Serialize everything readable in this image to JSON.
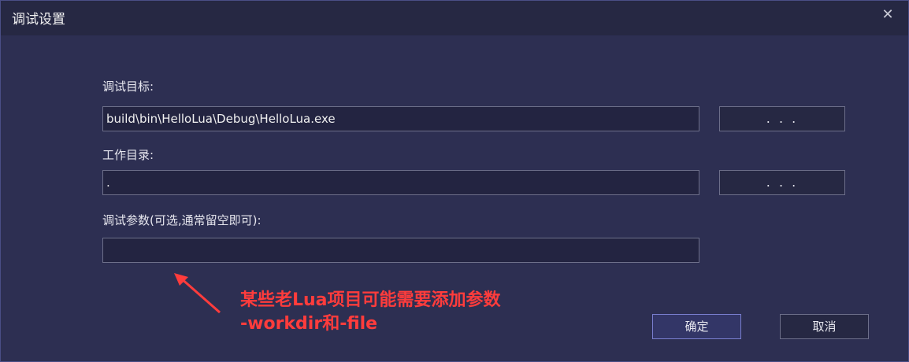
{
  "dialog": {
    "title": "调试设置",
    "close_icon": "close-icon"
  },
  "form": {
    "target_label": "调试目标:",
    "target_value": "build\\bin\\HelloLua\\Debug\\HelloLua.exe",
    "workdir_label": "工作目录:",
    "workdir_value": ".",
    "args_label": "调试参数(可选,通常留空即可):",
    "args_value": "",
    "browse_label": ". . ."
  },
  "buttons": {
    "ok_label": "确定",
    "cancel_label": "取消"
  },
  "annotation": {
    "line1": "某些老Lua项目可能需要添加参数",
    "line2": "-workdir和-file",
    "color": "#ff3c3c"
  },
  "colors": {
    "background": "#2d2f52",
    "titlebar": "#262843",
    "field": "#232441",
    "accent_border": "#7a7fd0"
  }
}
